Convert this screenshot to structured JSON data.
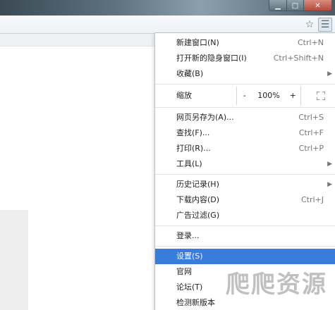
{
  "window": {
    "minimize_icon": "minimize-icon",
    "maximize_icon": "maximize-icon",
    "close_icon": "close-icon"
  },
  "toolbar": {
    "star_icon": "star-icon",
    "menu_icon": "hamburger-menu-icon"
  },
  "menu": {
    "new_window": {
      "label": "新建窗口(N)",
      "shortcut": "Ctrl+N"
    },
    "incognito": {
      "label": "打开新的隐身窗口(I)",
      "shortcut": "Ctrl+Shift+N"
    },
    "bookmarks": {
      "label": "收藏(B)"
    },
    "zoom": {
      "label": "缩放",
      "minus": "-",
      "value": "100%",
      "plus": "+"
    },
    "save_as": {
      "label": "网页另存为(A)...",
      "shortcut": "Ctrl+S"
    },
    "find": {
      "label": "查找(F)...",
      "shortcut": "Ctrl+F"
    },
    "print": {
      "label": "打印(R)...",
      "shortcut": "Ctrl+P"
    },
    "tools": {
      "label": "工具(L)"
    },
    "history": {
      "label": "历史记录(H)"
    },
    "downloads": {
      "label": "下载内容(D)",
      "shortcut": "Ctrl+J"
    },
    "adblock": {
      "label": "广告过滤(G)"
    },
    "login": {
      "label": "登录..."
    },
    "settings": {
      "label": "设置(S)"
    },
    "official_site": {
      "label": "官网"
    },
    "forum": {
      "label": "论坛(T)"
    },
    "check_update": {
      "label": "检测新版本"
    }
  },
  "watermark": {
    "text": "爬爬资源"
  },
  "colors": {
    "highlight": "#3a7cdc",
    "titlebar": "#5f7380"
  }
}
